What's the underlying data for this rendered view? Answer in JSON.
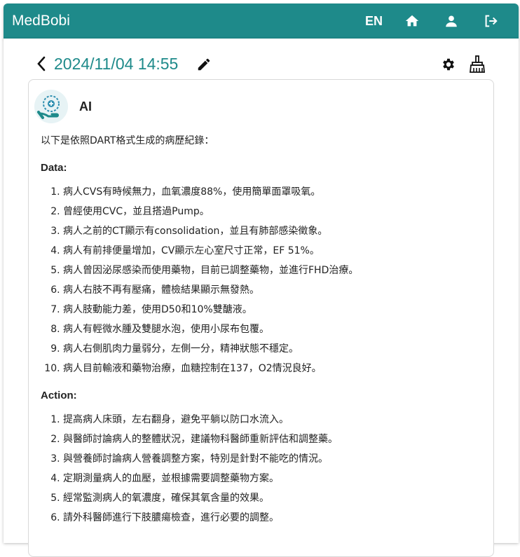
{
  "app": {
    "brand": "MedBobi",
    "language": "EN",
    "nav_icons": [
      "home-icon",
      "user-icon",
      "logout-icon"
    ],
    "primary_color": "#1e8a8a"
  },
  "record": {
    "datetime": "2024/11/04 14:55"
  },
  "message": {
    "sender": "AI",
    "intro": "以下是依照DART格式生成的病歷紀錄：",
    "sections": [
      {
        "title": "Data:",
        "items": [
          "病人CVS有時候無力，血氧濃度88%，使用簡單面罩吸氧。",
          "曾經使用CVC，並且搭過Pump。",
          "病人之前的CT顯示有consolidation，並且有肺部感染徵象。",
          "病人有前排便量增加，CV顯示左心室尺寸正常，EF 51%。",
          "病人曾因泌尿感染而使用藥物，目前已調整藥物，並進行FHD治療。",
          "病人右肢不再有壓痛，體檢結果顯示無發熱。",
          "病人肢動能力差，使用D50和10%雙醣液。",
          "病人有輕微水腫及雙腿水泡，使用小尿布包覆。",
          "病人右側肌肉力量弱分，左側一分，精神狀態不穩定。",
          "病人目前輸液和藥物治療，血糖控制在137，O2情況良好。"
        ]
      },
      {
        "title": "Action:",
        "items": [
          "提高病人床頭，左右翻身，避免平躺以防口水流入。",
          "與醫師討論病人的整體狀況，建議物科醫師重新評估和調整藥。",
          "與營養師討論病人營養調整方案，特別是針對不能吃的情況。",
          "定期測量病人的血壓，並根據需要調整藥物方案。",
          "經常監測病人的氧濃度，確保其氧含量的效果。",
          "請外科醫師進行下肢膿瘍檢查，進行必要的調整。"
        ]
      }
    ]
  }
}
